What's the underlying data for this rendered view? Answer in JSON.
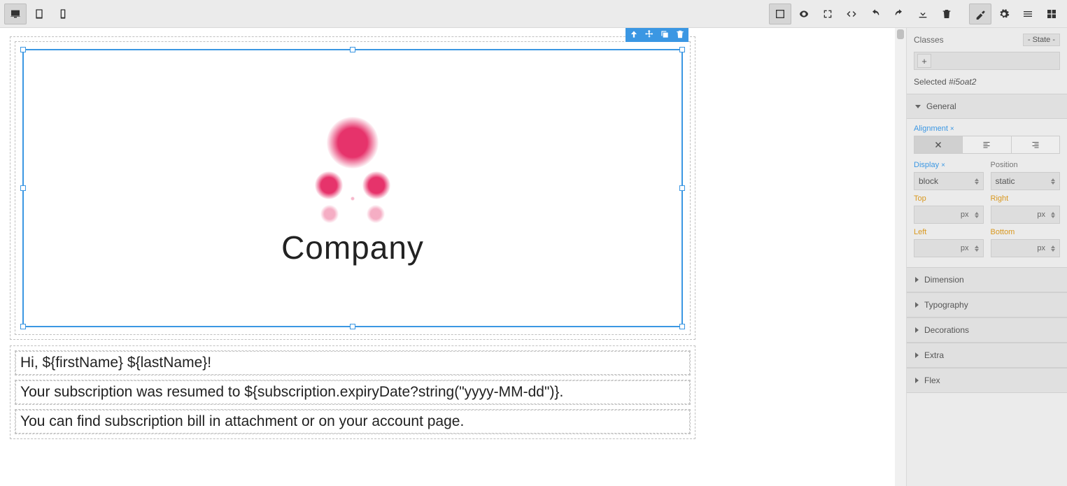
{
  "sidebar": {
    "classes_label": "Classes",
    "state_label": "- State -",
    "selected_prefix": "Selected ",
    "selected_id": "#i5oat2",
    "sections": {
      "general": "General",
      "dimension": "Dimension",
      "typography": "Typography",
      "decorations": "Decorations",
      "extra": "Extra",
      "flex": "Flex"
    },
    "general": {
      "alignment_label": "Alignment",
      "display_label": "Display",
      "display_value": "block",
      "position_label": "Position",
      "position_value": "static",
      "top_label": "Top",
      "right_label": "Right",
      "left_label": "Left",
      "bottom_label": "Bottom",
      "unit": "px"
    }
  },
  "canvas": {
    "logo_text": "Company",
    "greeting": "Hi, ${firstName} ${lastName}!",
    "body1": "Your subscription was resumed to ${subscription.expiryDate?string(\"yyyy-MM-dd\")}.",
    "body2": "You can find subscription bill in attachment or on your account page."
  }
}
